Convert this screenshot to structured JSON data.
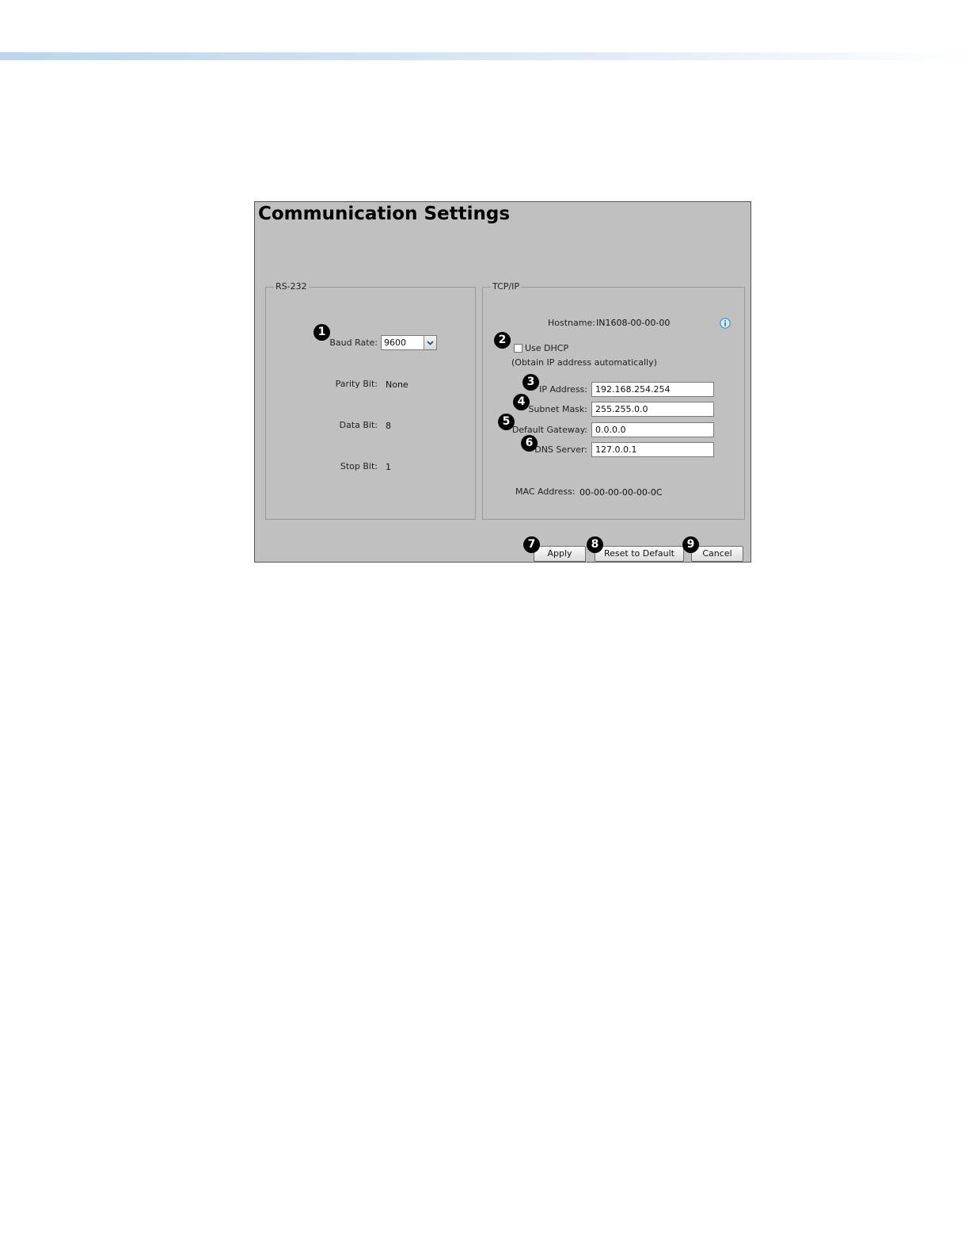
{
  "window": {
    "title": "Communication Settings"
  },
  "rs232": {
    "legend": "RS-232",
    "baud_rate_label": "Baud Rate:",
    "baud_rate_value": "9600",
    "parity_bit_label": "Parity Bit:",
    "parity_bit_value": "None",
    "data_bit_label": "Data Bit:",
    "data_bit_value": "8",
    "stop_bit_label": "Stop Bit:",
    "stop_bit_value": "1"
  },
  "tcpip": {
    "legend": "TCP/IP",
    "hostname_label": "Hostname:",
    "hostname_value": "IN1608-00-00-00",
    "use_dhcp_label": "Use DHCP",
    "use_dhcp_checked": false,
    "dhcp_note": "(Obtain IP address automatically)",
    "ip_address_label": "IP Address:",
    "ip_address_value": "192.168.254.254",
    "subnet_mask_label": "Subnet Mask:",
    "subnet_mask_value": "255.255.0.0",
    "default_gateway_label": "Default Gateway:",
    "default_gateway_value": "0.0.0.0",
    "dns_server_label": "DNS Server:",
    "dns_server_value": "127.0.0.1",
    "mac_address_label": "MAC Address:",
    "mac_address_value": "00-00-00-00-00-0C"
  },
  "buttons": {
    "apply": "Apply",
    "reset": "Reset to Default",
    "cancel": "Cancel"
  },
  "callouts": [
    "1",
    "2",
    "3",
    "4",
    "5",
    "6",
    "7",
    "8",
    "9"
  ],
  "icons": {
    "info": "info-icon",
    "dropdown": "chevron-down-icon"
  },
  "colors": {
    "panel_background": "#c0c0c0",
    "info_icon": "#3d8fd6",
    "top_bar": "#bcd4ec"
  }
}
